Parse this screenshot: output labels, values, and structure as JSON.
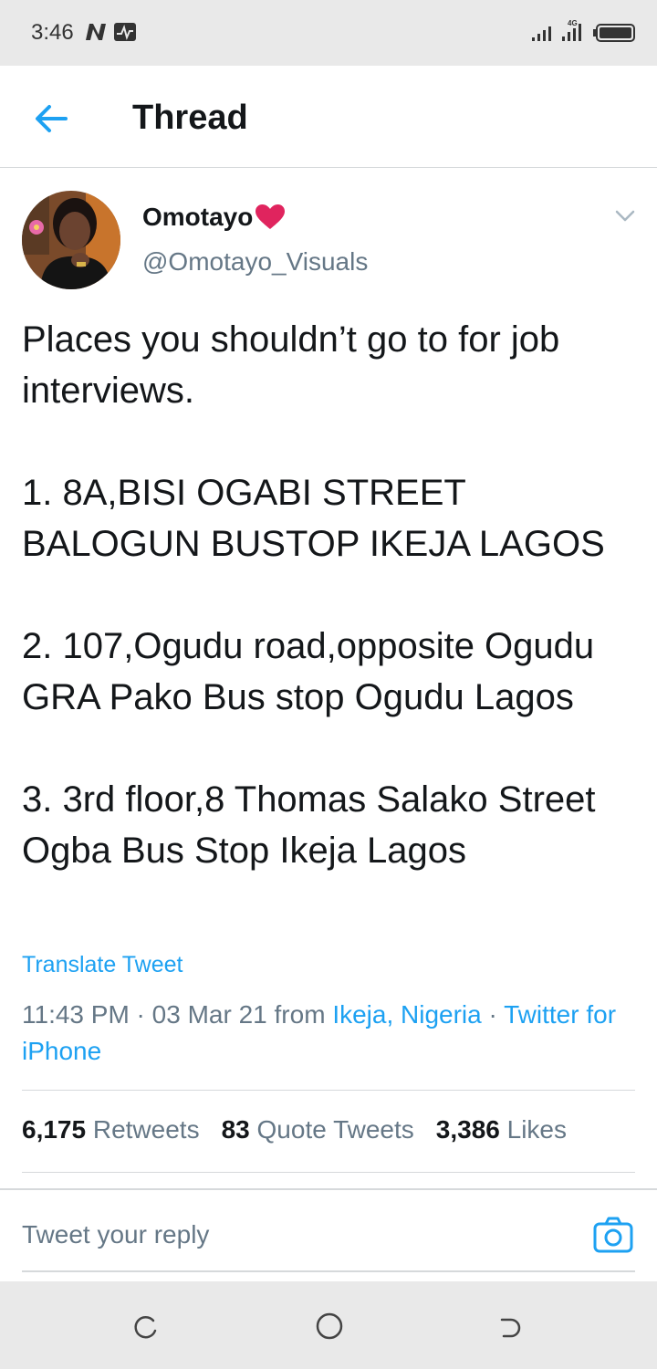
{
  "status_bar": {
    "time": "3:46",
    "network_label": "4G"
  },
  "header": {
    "title": "Thread",
    "back_icon": "arrow-left-icon"
  },
  "tweet": {
    "display_name": "Omotayo",
    "name_emoji": "red-heart-icon",
    "handle": "@Omotayo_Visuals",
    "text": "Places you shouldn’t go to for job interviews.\n\n1. 8A,BISI OGABI STREET BALOGUN BUSTOP IKEJA LAGOS\n\n2. 107,Ogudu road,opposite Ogudu GRA Pako Bus stop Ogudu Lagos\n\n3. 3rd floor,8 Thomas Salako Street Ogba Bus Stop Ikeja Lagos",
    "translate_label": "Translate Tweet",
    "time": "11:43 PM",
    "separator": " · ",
    "date": "03 Mar 21",
    "from_label": " from ",
    "location": "Ikeja, Nigeria",
    "source": "Twitter for iPhone",
    "stats": {
      "retweets_count": "6,175",
      "retweets_label": "Retweets",
      "quotes_count": "83",
      "quotes_label": "Quote Tweets",
      "likes_count": "3,386",
      "likes_label": "Likes"
    }
  },
  "reply": {
    "placeholder": "Tweet your reply",
    "camera_icon": "camera-icon"
  },
  "colors": {
    "accent": "#1da1f2",
    "text": "#14171a",
    "secondary": "#657786",
    "heart": "#e0245e"
  }
}
